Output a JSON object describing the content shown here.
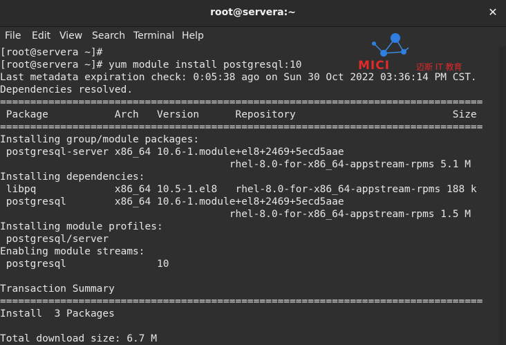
{
  "window": {
    "title": "root@servera:~"
  },
  "menu": [
    "File",
    "Edit",
    "View",
    "Search",
    "Terminal",
    "Help"
  ],
  "watermark": {
    "brand": "MICI",
    "tagline": "迈斯 IT 教育",
    "color": "#e12a2a"
  },
  "terminal": {
    "lines": [
      "[root@servera ~]#",
      "[root@servera ~]# yum module install postgresql:10",
      "Last metadata expiration check: 0:05:38 ago on Sun 30 Oct 2022 03:36:14 PM CST.",
      "Dependencies resolved.",
      "================================================================================",
      " Package           Arch   Version      Repository                          Size",
      "================================================================================",
      "Installing group/module packages:",
      " postgresql-server x86_64 10.6-1.module+el8+2469+5ecd5aae",
      "                                      rhel-8.0-for-x86_64-appstream-rpms 5.1 M",
      "Installing dependencies:",
      " libpq             x86_64 10.5-1.el8   rhel-8.0-for-x86_64-appstream-rpms 188 k",
      " postgresql        x86_64 10.6-1.module+el8+2469+5ecd5aae",
      "                                      rhel-8.0-for-x86_64-appstream-rpms 1.5 M",
      "Installing module profiles:",
      " postgresql/server",
      "Enabling module streams:",
      " postgresql               10",
      "",
      "Transaction Summary",
      "================================================================================",
      "Install  3 Packages",
      "",
      "Total download size: 6.7 M"
    ]
  }
}
